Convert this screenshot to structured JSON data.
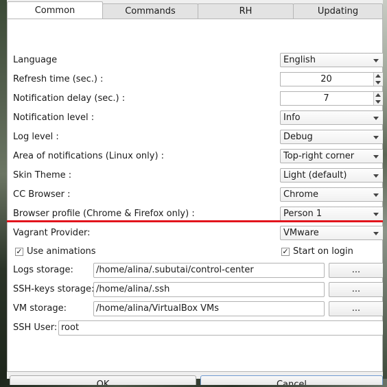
{
  "tabs": [
    {
      "label": "Common",
      "active": true
    },
    {
      "label": "Commands",
      "active": false
    },
    {
      "label": "RH",
      "active": false
    },
    {
      "label": "Updating",
      "active": false
    }
  ],
  "settings": {
    "language": {
      "label": "Language",
      "value": "English"
    },
    "refresh_time": {
      "label": "Refresh time (sec.) :",
      "value": "20"
    },
    "notification_delay": {
      "label": "Notification delay (sec.) :",
      "value": "7"
    },
    "notification_level": {
      "label": "Notification level :",
      "value": "Info"
    },
    "log_level": {
      "label": "Log level :",
      "value": "Debug"
    },
    "notification_area": {
      "label": "Area of notifications (Linux only) :",
      "value": "Top-right corner"
    },
    "skin_theme": {
      "label": "Skin Theme :",
      "value": "Light (default)"
    },
    "cc_browser": {
      "label": "CC Browser :",
      "value": "Chrome"
    },
    "browser_profile": {
      "label": "Browser profile (Chrome & Firefox only) :",
      "value": "Person 1"
    },
    "vagrant_provider": {
      "label": "Vagrant Provider:",
      "value": "VMware"
    }
  },
  "checkboxes": {
    "use_animations": {
      "label": "Use animations",
      "checked": true,
      "mark": "✓"
    },
    "start_on_login": {
      "label": "Start on login",
      "checked": true,
      "mark": "✓"
    }
  },
  "paths": {
    "logs_storage": {
      "label": "Logs storage:",
      "value": "/home/alina/.subutai/control-center"
    },
    "ssh_keys_storage": {
      "label": "SSH-keys storage:",
      "value": "/home/alina/.ssh"
    },
    "vm_storage": {
      "label": "VM storage:",
      "value": "/home/alina/VirtualBox VMs"
    },
    "browse_label": "..."
  },
  "ssh_user": {
    "label": "SSH User:",
    "value": "root"
  },
  "dialog_buttons": {
    "ok": "OK",
    "cancel": "Cancel"
  },
  "colors": {
    "highlight_line": "#e2141c"
  }
}
